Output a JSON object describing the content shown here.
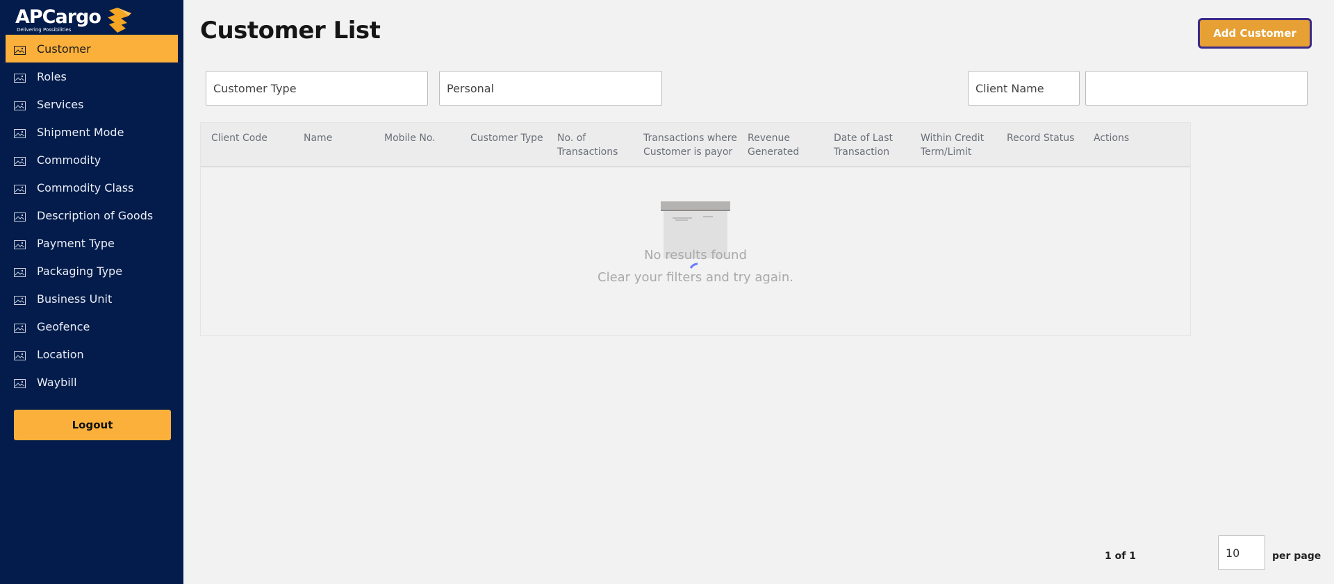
{
  "brand": {
    "name": "APCargo",
    "tagline": "Delivering Possibilities",
    "primary_color": "#031c4b",
    "accent_color": "#fbb03b"
  },
  "sidebar": {
    "items": [
      {
        "label": "Customer",
        "active": true,
        "icon": "image-icon"
      },
      {
        "label": "Roles",
        "active": false,
        "icon": "image-icon"
      },
      {
        "label": "Services",
        "active": false,
        "icon": "image-icon"
      },
      {
        "label": "Shipment Mode",
        "active": false,
        "icon": "image-icon"
      },
      {
        "label": "Commodity",
        "active": false,
        "icon": "image-icon"
      },
      {
        "label": "Commodity Class",
        "active": false,
        "icon": "image-icon"
      },
      {
        "label": "Description of Goods",
        "active": false,
        "icon": "image-icon"
      },
      {
        "label": "Payment Type",
        "active": false,
        "icon": "image-icon"
      },
      {
        "label": "Packaging Type",
        "active": false,
        "icon": "image-icon"
      },
      {
        "label": "Business Unit",
        "active": false,
        "icon": "image-icon"
      },
      {
        "label": "Geofence",
        "active": false,
        "icon": "image-icon"
      },
      {
        "label": "Location",
        "active": false,
        "icon": "image-icon"
      },
      {
        "label": "Waybill",
        "active": false,
        "icon": "image-icon"
      }
    ],
    "logout_label": "Logout"
  },
  "header": {
    "title": "Customer List",
    "add_button_label": "Add Customer"
  },
  "filters": {
    "customer_type": {
      "placeholder": "Customer Type",
      "value": ""
    },
    "personal": {
      "placeholder": "Personal",
      "value": ""
    },
    "client_name": {
      "placeholder": "Client Name",
      "value": ""
    },
    "search": {
      "placeholder": "",
      "value": ""
    }
  },
  "table": {
    "columns": [
      "Client Code",
      "Name",
      "Mobile No.",
      "Customer Type",
      "No. of Transactions",
      "Transactions where Customer is payor",
      "Revenue Generated",
      "Date of Last Transaction",
      "Within Credit Term/Limit",
      "Record Status",
      "Actions"
    ],
    "rows": [],
    "empty_title": "No results found",
    "empty_subtitle": "Clear your filters and try again."
  },
  "pagination": {
    "page_text": "1 of 1",
    "per_page_value": "10",
    "per_page_label": "per page"
  }
}
